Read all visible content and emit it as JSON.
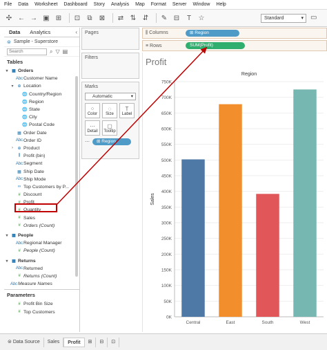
{
  "menu": [
    "File",
    "Data",
    "Worksheet",
    "Dashboard",
    "Story",
    "Analysis",
    "Map",
    "Format",
    "Server",
    "Window",
    "Help"
  ],
  "toolbar": {
    "mode": "Standard"
  },
  "left_pane": {
    "tabs": [
      "Data",
      "Analytics"
    ],
    "datasource": "Sample - Superstore",
    "search_placeholder": "Search",
    "tables_header": "Tables",
    "orders": [
      {
        "tw": "▾",
        "ic": "▦",
        "label": "Orders",
        "cls": "bold",
        "indent": 0
      },
      {
        "tw": "",
        "ic": "Abc",
        "label": "Customer Name",
        "cls": "",
        "indent": 1
      },
      {
        "tw": "▾",
        "ic": "⊕",
        "label": "Location",
        "cls": "",
        "indent": 1
      },
      {
        "tw": "",
        "ic": "🌐",
        "label": "Country/Region",
        "cls": "",
        "indent": 2
      },
      {
        "tw": "",
        "ic": "🌐",
        "label": "Region",
        "cls": "",
        "indent": 2
      },
      {
        "tw": "",
        "ic": "🌐",
        "label": "State",
        "cls": "",
        "indent": 2
      },
      {
        "tw": "",
        "ic": "🌐",
        "label": "City",
        "cls": "",
        "indent": 2
      },
      {
        "tw": "",
        "ic": "🌐",
        "label": "Postal Code",
        "cls": "",
        "indent": 2
      },
      {
        "tw": "",
        "ic": "▦",
        "label": "Order Date",
        "cls": "",
        "indent": 1
      },
      {
        "tw": "",
        "ic": "Abc",
        "label": "Order ID",
        "cls": "",
        "indent": 1
      },
      {
        "tw": "›",
        "ic": "⊕",
        "label": "Product",
        "cls": "",
        "indent": 1
      },
      {
        "tw": "",
        "ic": "⫼",
        "label": "Profit (bin)",
        "cls": "",
        "indent": 1
      },
      {
        "tw": "",
        "ic": "Abc",
        "label": "Segment",
        "cls": "",
        "indent": 1
      },
      {
        "tw": "",
        "ic": "▦",
        "label": "Ship Date",
        "cls": "",
        "indent": 1
      },
      {
        "tw": "",
        "ic": "Abc",
        "label": "Ship Mode",
        "cls": "",
        "indent": 1
      },
      {
        "tw": "",
        "ic": "∞",
        "label": "Top Customers by P...",
        "cls": "",
        "indent": 1
      },
      {
        "tw": "",
        "ic": "#",
        "label": "Discount",
        "cls": "m",
        "indent": 1
      },
      {
        "tw": "",
        "ic": "#",
        "label": "Profit",
        "cls": "m",
        "indent": 1
      },
      {
        "tw": "",
        "ic": "#",
        "label": "Quantity",
        "cls": "m",
        "indent": 1
      },
      {
        "tw": "",
        "ic": "#",
        "label": "Sales",
        "cls": "m",
        "indent": 1
      },
      {
        "tw": "",
        "ic": "#",
        "label": "Orders (Count)",
        "cls": "m ital",
        "indent": 1
      }
    ],
    "people": [
      {
        "tw": "▾",
        "ic": "▦",
        "label": "People",
        "cls": "bold",
        "indent": 0
      },
      {
        "tw": "",
        "ic": "Abc",
        "label": "Regional Manager",
        "cls": "",
        "indent": 1
      },
      {
        "tw": "",
        "ic": "#",
        "label": "People (Count)",
        "cls": "m ital",
        "indent": 1
      }
    ],
    "returns": [
      {
        "tw": "▾",
        "ic": "▦",
        "label": "Returns",
        "cls": "bold",
        "indent": 0
      },
      {
        "tw": "",
        "ic": "Abc",
        "label": "Returned",
        "cls": "",
        "indent": 1
      },
      {
        "tw": "",
        "ic": "#",
        "label": "Returns (Count)",
        "cls": "m ital",
        "indent": 1
      },
      {
        "tw": "",
        "ic": "Abc",
        "label": "Measure Names",
        "cls": "ital",
        "indent": 0
      }
    ],
    "parameters_header": "Parameters",
    "parameters": [
      {
        "tw": "",
        "ic": "#",
        "label": "Profit Bin Size",
        "cls": "m",
        "indent": 1
      },
      {
        "tw": "",
        "ic": "#",
        "label": "Top Customers",
        "cls": "m",
        "indent": 1
      }
    ]
  },
  "cards": {
    "pages": "Pages",
    "filters": "Filters",
    "marks": "Marks",
    "marks_type": "Automatic",
    "mark_buttons": [
      {
        "icon": "⁘",
        "label": "Color"
      },
      {
        "icon": "◌",
        "label": "Size"
      },
      {
        "icon": "T",
        "label": "Label"
      },
      {
        "icon": "⋯",
        "label": "Detail"
      },
      {
        "icon": "▢",
        "label": "Tooltip"
      }
    ],
    "marks_pill": "⊞ Region"
  },
  "shelves": {
    "columns_label": "Columns",
    "rows_label": "Rows",
    "columns_pill": "⊞ Region",
    "rows_pill": "SUM(Profit)"
  },
  "viz_title": "Profit",
  "chart_data": {
    "type": "bar",
    "title": "Region",
    "xlabel": "",
    "ylabel": "Sales",
    "categories": [
      "Central",
      "East",
      "South",
      "West"
    ],
    "values": [
      502000,
      678000,
      392000,
      725000
    ],
    "colors": [
      "#4e79a7",
      "#f28e2b",
      "#e15759",
      "#76b7b2"
    ],
    "ylim": [
      0,
      750000
    ],
    "yticks": [
      "0K",
      "50K",
      "100K",
      "150K",
      "200K",
      "250K",
      "300K",
      "350K",
      "400K",
      "450K",
      "500K",
      "550K",
      "600K",
      "650K",
      "700K",
      "750K"
    ]
  },
  "bottom_tabs": [
    "Data Source",
    "Sales",
    "Profit"
  ],
  "annotation_color": "#c00000"
}
